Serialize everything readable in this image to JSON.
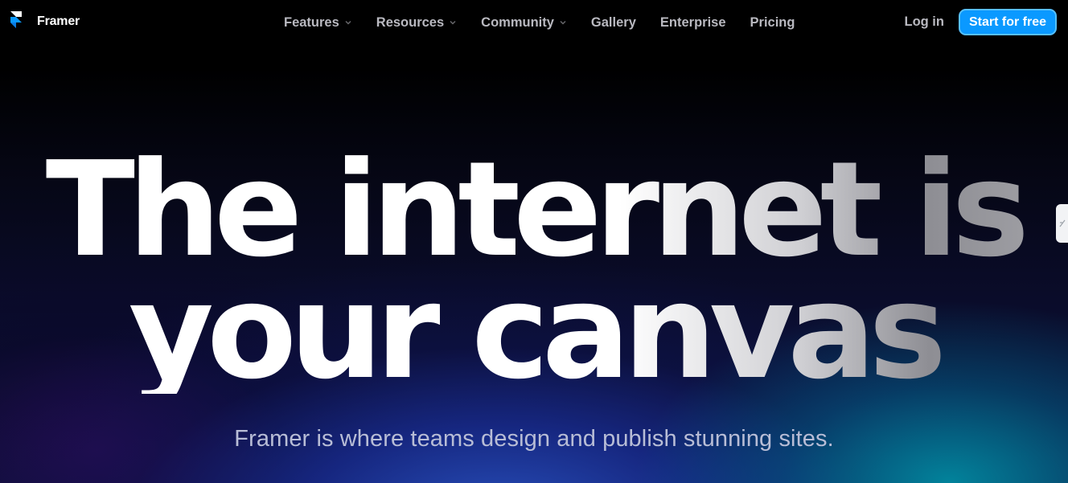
{
  "brand": {
    "name": "Framer",
    "logo_icon": "framer-logo-icon",
    "colors": {
      "logo_top": "#ffffff",
      "logo_bottom": "#0a99ff"
    }
  },
  "nav": {
    "items": [
      {
        "label": "Features",
        "has_dropdown": true
      },
      {
        "label": "Resources",
        "has_dropdown": true
      },
      {
        "label": "Community",
        "has_dropdown": true
      },
      {
        "label": "Gallery",
        "has_dropdown": false
      },
      {
        "label": "Enterprise",
        "has_dropdown": false
      },
      {
        "label": "Pricing",
        "has_dropdown": false
      }
    ],
    "login_label": "Log in",
    "cta_label": "Start for free",
    "cta_color": "#0a99ff"
  },
  "hero": {
    "title_line1": "The internet is",
    "title_line2": "your canvas",
    "subtitle": "Framer is where teams design and publish stunning sites."
  },
  "side_tab": {
    "icon": "extension-tab-icon"
  }
}
